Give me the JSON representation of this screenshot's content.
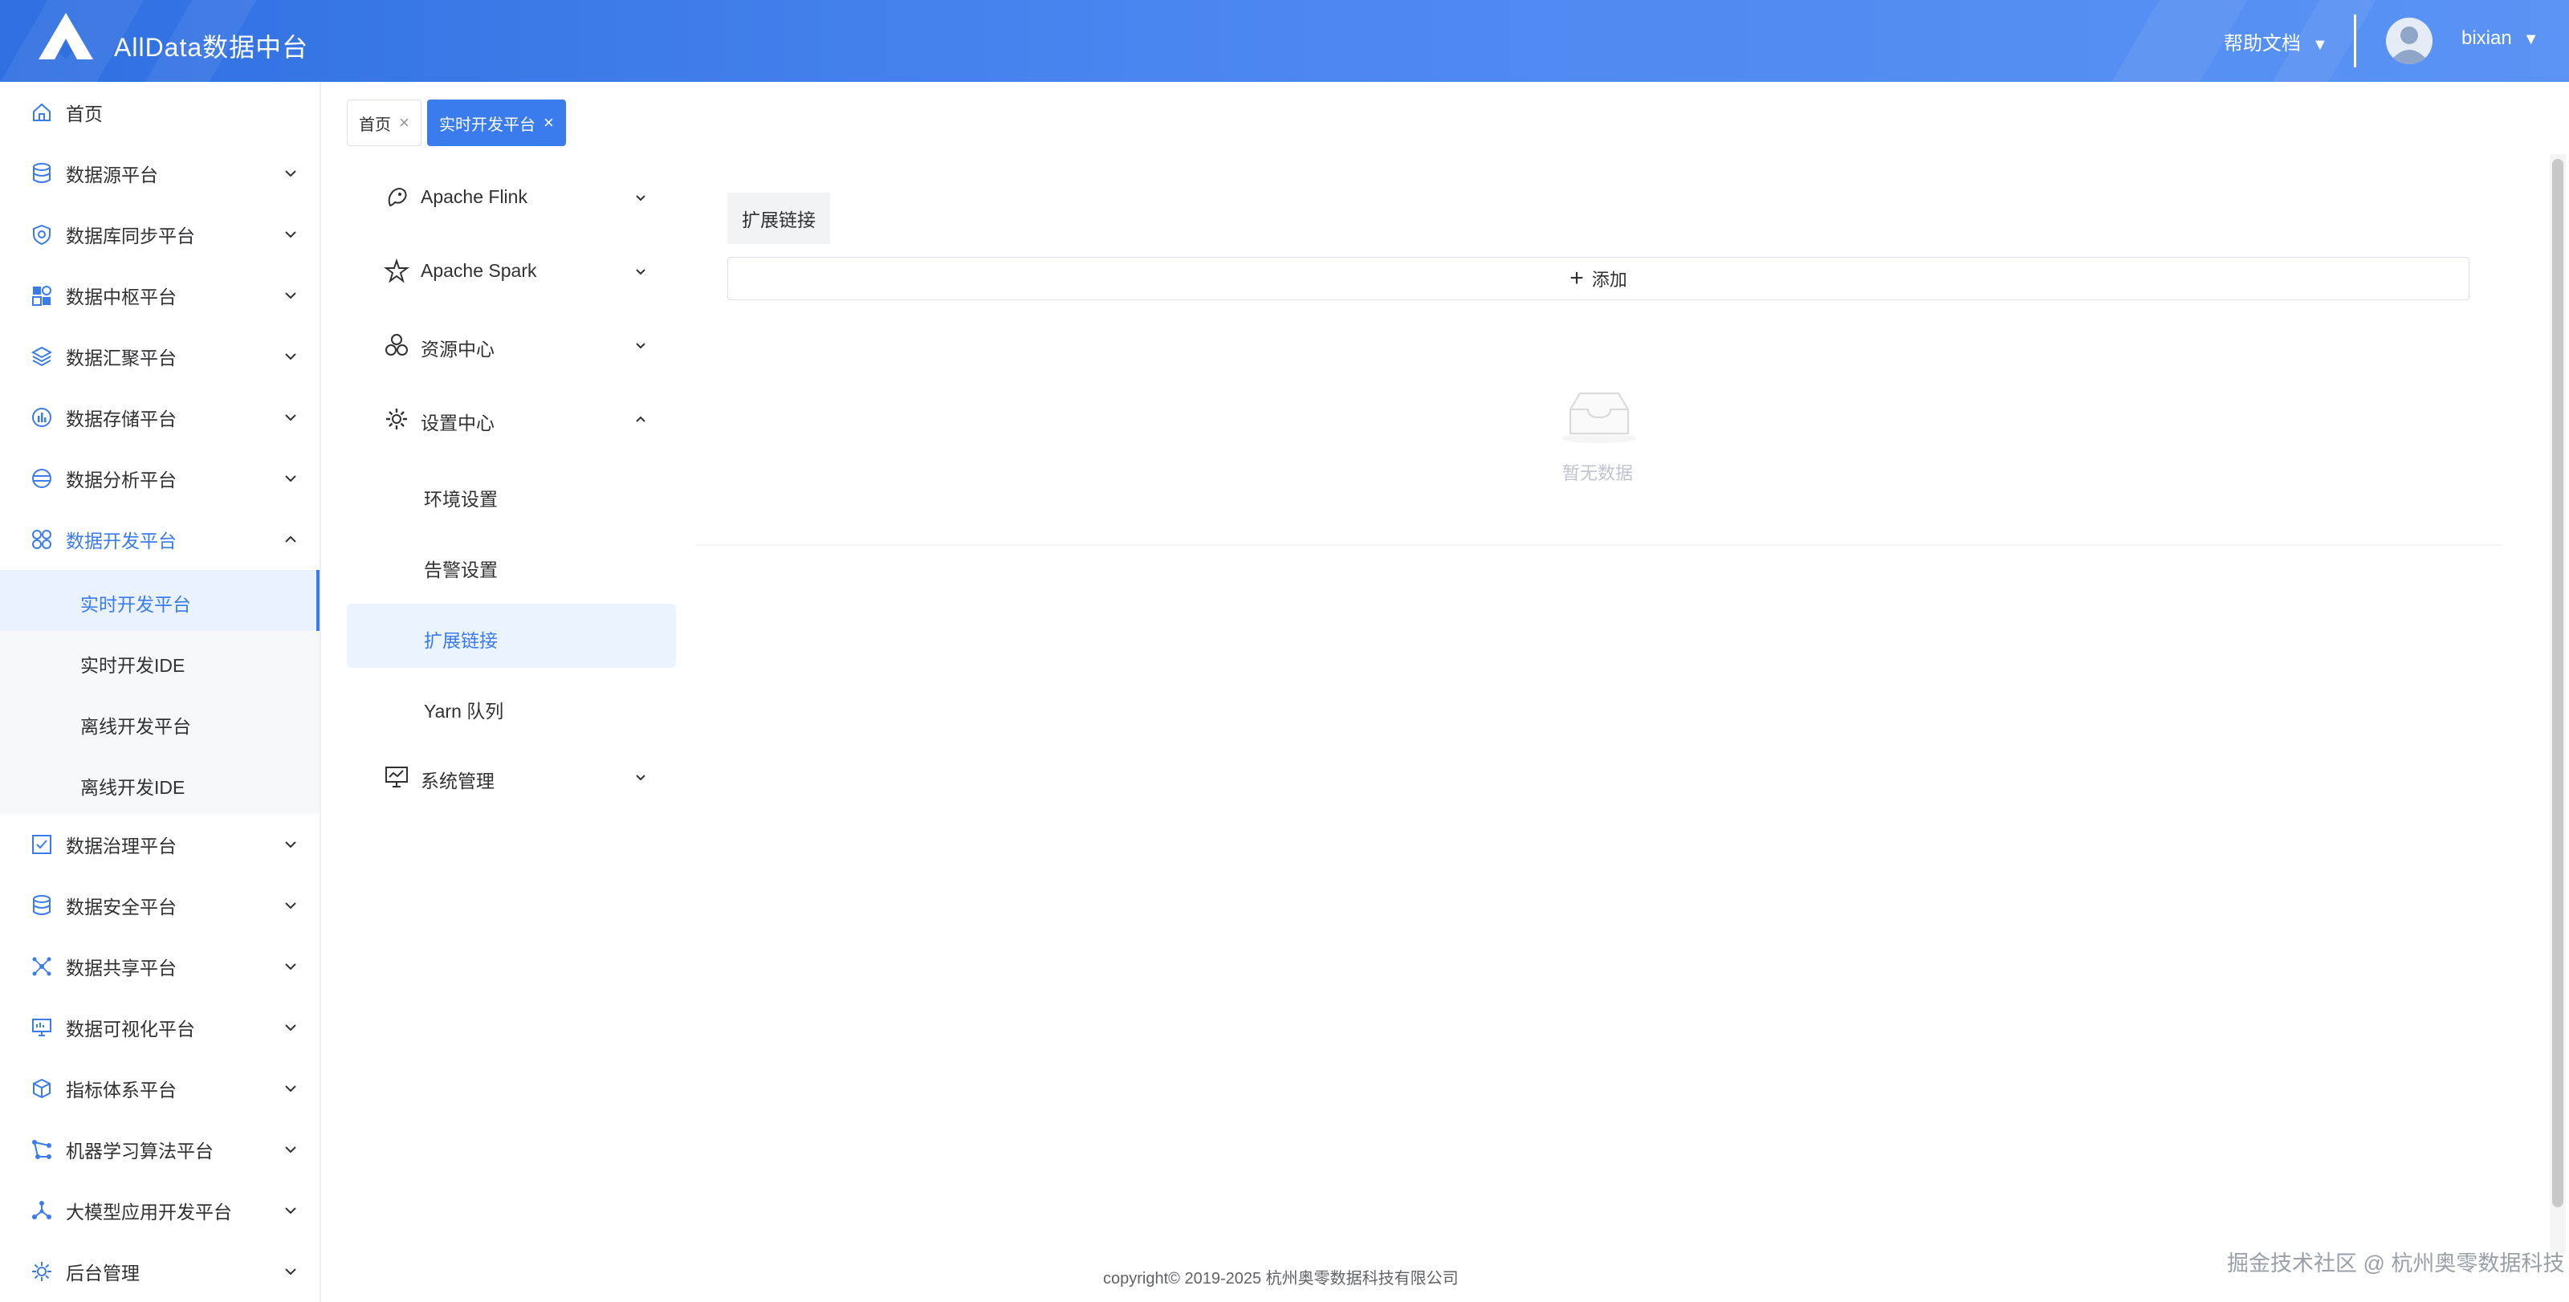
{
  "header": {
    "app_title": "AllData数据中台",
    "help_label": "帮助文档",
    "help_caret": "▼",
    "user_name": "bixian",
    "user_caret": "▼"
  },
  "sidebar": {
    "items": [
      {
        "label": "首页",
        "icon": "home-icon"
      },
      {
        "label": "数据源平台",
        "icon": "database-icon"
      },
      {
        "label": "数据库同步平台",
        "icon": "sync-shield-icon"
      },
      {
        "label": "数据中枢平台",
        "icon": "blocks-icon"
      },
      {
        "label": "数据汇聚平台",
        "icon": "layers-icon"
      },
      {
        "label": "数据存储平台",
        "icon": "storage-chart-icon"
      },
      {
        "label": "数据分析平台",
        "icon": "analysis-globe-icon"
      },
      {
        "label": "数据开发平台",
        "icon": "grid-four-icon",
        "expanded": true
      },
      {
        "label": "数据治理平台",
        "icon": "checkbox-icon"
      },
      {
        "label": "数据安全平台",
        "icon": "database-icon"
      },
      {
        "label": "数据共享平台",
        "icon": "share-network-icon"
      },
      {
        "label": "数据可视化平台",
        "icon": "monitor-icon"
      },
      {
        "label": "指标体系平台",
        "icon": "cube-icon"
      },
      {
        "label": "机器学习算法平台",
        "icon": "graph-icon"
      },
      {
        "label": "大模型应用开发平台",
        "icon": "nodes-icon"
      },
      {
        "label": "后台管理",
        "icon": "settings-gear-icon"
      }
    ],
    "sub_items": [
      {
        "label": "实时开发平台",
        "selected": true
      },
      {
        "label": "实时开发IDE"
      },
      {
        "label": "离线开发平台"
      },
      {
        "label": "离线开发IDE"
      }
    ]
  },
  "tabs": [
    {
      "label": "首页",
      "close": "×"
    },
    {
      "label": "实时开发平台",
      "close": "×",
      "active": true
    }
  ],
  "inner_menu": {
    "items": [
      {
        "label": "Apache Flink",
        "icon": "flink-squirrel-icon"
      },
      {
        "label": "Apache Spark",
        "icon": "spark-star-icon"
      },
      {
        "label": "资源中心",
        "icon": "resource-cluster-icon"
      },
      {
        "label": "设置中心",
        "icon": "gear-icon",
        "expanded": true
      },
      {
        "label": "系统管理",
        "icon": "monitor-chart-icon"
      }
    ],
    "sub_items": [
      {
        "label": "环境设置"
      },
      {
        "label": "告警设置"
      },
      {
        "label": "扩展链接",
        "selected": true
      },
      {
        "label": "Yarn 队列"
      }
    ]
  },
  "content": {
    "section_label": "扩展链接",
    "add_button": "添加",
    "add_icon": "+",
    "empty_text": "暂无数据"
  },
  "footer": {
    "copyright": "copyright© 2019-2025 杭州奥零数据科技有限公司",
    "watermark": "掘金技术社区 @ 杭州奥零数据科技"
  },
  "colors": {
    "primary": "#3a7bee",
    "header_start": "#2f6fe0",
    "header_end": "#5a93f4",
    "submenu_bg": "#f7f8fa",
    "selected_bg": "#ebf3fe"
  }
}
